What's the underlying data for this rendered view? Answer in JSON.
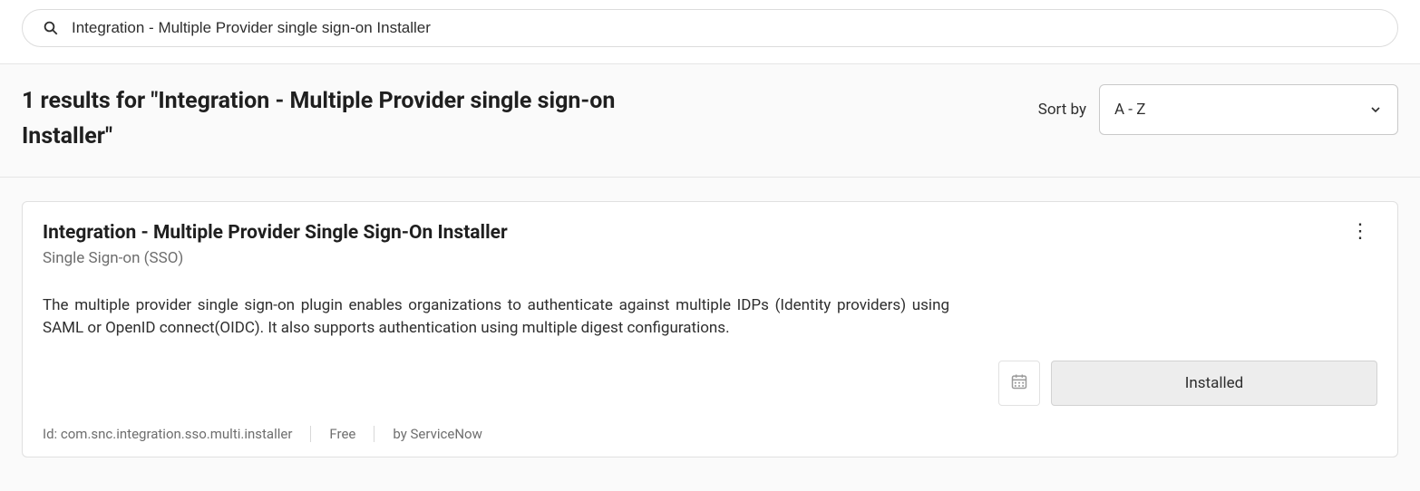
{
  "search": {
    "value": "Integration - Multiple Provider single sign-on Installer"
  },
  "results_header": {
    "title": "1 results for \"Integration - Multiple Provider single sign-on Installer\"",
    "sort_label": "Sort by",
    "sort_value": "A - Z"
  },
  "result": {
    "title": "Integration - Multiple Provider Single Sign-On Installer",
    "subtitle": "Single Sign-on (SSO)",
    "description": "The multiple provider single sign-on plugin enables organizations to authenticate against multiple IDPs (Identity providers) using SAML or OpenID connect(OIDC). It also supports authentication using multiple digest configurations.",
    "install_label": "Installed",
    "meta": {
      "id": "Id: com.snc.integration.sso.multi.installer",
      "pricing": "Free",
      "vendor": "by ServiceNow"
    }
  }
}
